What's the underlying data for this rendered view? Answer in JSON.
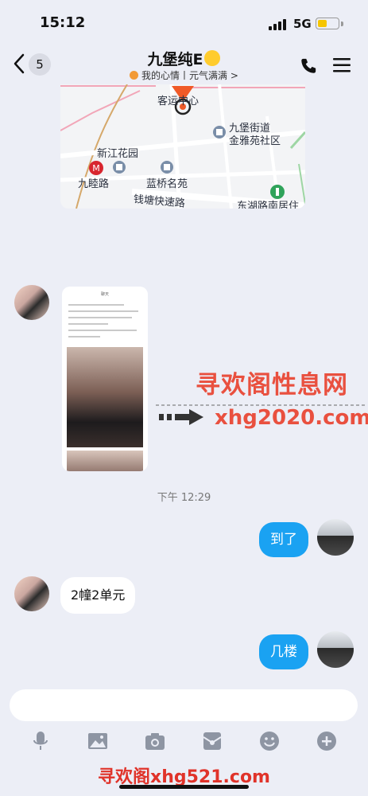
{
  "status": {
    "time": "15:12",
    "network": "5G",
    "battery_level": 0.45
  },
  "header": {
    "back_count": "5",
    "title": "九堡纯E",
    "subtitle": "我的心情丨元气满满",
    "subtitle_chevron": ">"
  },
  "map": {
    "labels": {
      "keyun": "客运中心",
      "jiubao_street": "九堡街道",
      "jinya": "金雅苑社区",
      "xinjiang": "新江花园",
      "jiuling": "九睦路",
      "lanqiao": "蓝桥名苑",
      "qiantang": "钱塘快速路",
      "dong": "东湖路南居住"
    }
  },
  "watermark": {
    "title": "寻欢阁性息网",
    "url": "xhg2020.com",
    "footer": "寻欢阁xhg521.com"
  },
  "image_message": {
    "header_text": "聊天"
  },
  "timestamp": "下午 12:29",
  "messages": {
    "m1": "到了",
    "m2": "2幢2单元",
    "m3": "几楼"
  },
  "colors": {
    "accent": "#1aa2f2",
    "watermark": "#e9503f",
    "background": "#eceef6"
  }
}
